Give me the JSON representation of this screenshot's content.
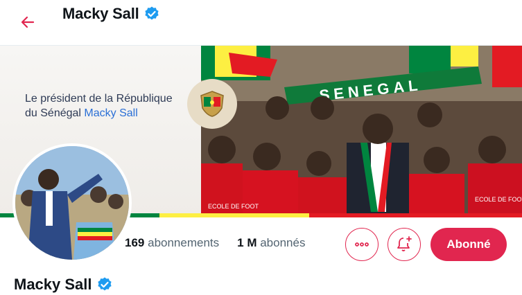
{
  "header": {
    "title": "Macky Sall",
    "verified_icon": "verified-badge-icon",
    "back_icon": "arrow-left-icon"
  },
  "banner": {
    "text_prefix": "Le président de la République du Sénégal",
    "text_highlight": "Macky Sall",
    "scarf_text": "SENEGAL",
    "jersey_text": "ECOLE DE FOOT OUSSEYNOU DIOP"
  },
  "stats": {
    "following_count": "169",
    "following_label": "abonnements",
    "followers_count": "1 M",
    "followers_label": "abonnés"
  },
  "actions": {
    "more_icon": "more-options-icon",
    "notify_icon": "bell-plus-icon",
    "subscribe_label": "Abonné"
  },
  "profile": {
    "name": "Macky Sall"
  },
  "colors": {
    "accent": "#e1264f",
    "verified": "#1d9bf0",
    "flag_green": "#00853f",
    "flag_yellow": "#fdef42",
    "flag_red": "#e31b23"
  }
}
